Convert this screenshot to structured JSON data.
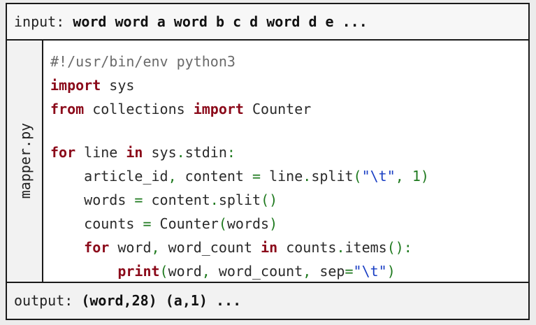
{
  "input": {
    "prefix": "input: ",
    "value": "word word a word b c d word d e ..."
  },
  "side_label": "mapper.py",
  "code": {
    "shebang": "#!/usr/bin/env python3",
    "import_kw": "import",
    "import_mod": " sys",
    "from_kw": "from",
    "from_mod": " collections ",
    "import_kw2": "import",
    "import_name": " Counter",
    "for_kw": "for",
    "for_var": " line ",
    "in_kw": "in",
    "for_src1": " sys",
    "dot": ".",
    "for_src2": "stdin",
    "colon": ":",
    "l5_indent": "    ",
    "l5_a": "article_id",
    "comma": ",",
    "l5_b": " content ",
    "eq": "=",
    "l5_c": " line",
    "l5_d": "split",
    "paren_open": "(",
    "tab_str": "\"\\t\"",
    "l5_e": " ",
    "one": "1",
    "paren_close": ")",
    "l6_a": "words ",
    "l6_b": " content",
    "l6_c": "split",
    "l6_paren": "()",
    "l7_a": "counts ",
    "l7_b": " Counter",
    "l7_c": "words",
    "l8_indent": "    ",
    "l8_for": "for",
    "l8_a": " word",
    "l8_b": " word_count ",
    "l8_in": "in",
    "l8_c": " counts",
    "l8_d": "items",
    "l8_paren": "():",
    "l9_indent": "        ",
    "l9_print": "print",
    "l9_a": "word",
    "l9_b": " word_count",
    "l9_c": " sep",
    "l9_str": "\"\\t\"",
    "l9_close": ")"
  },
  "output": {
    "prefix": "output: ",
    "item1_open": "(",
    "item1_word": "word",
    "item1_rest": ",28) (a,1) ..."
  },
  "colors": {
    "keyword": "#8b0a1a",
    "operator": "#1f7a1f",
    "string": "#1a3fc4",
    "comment": "#6a6a6a"
  }
}
